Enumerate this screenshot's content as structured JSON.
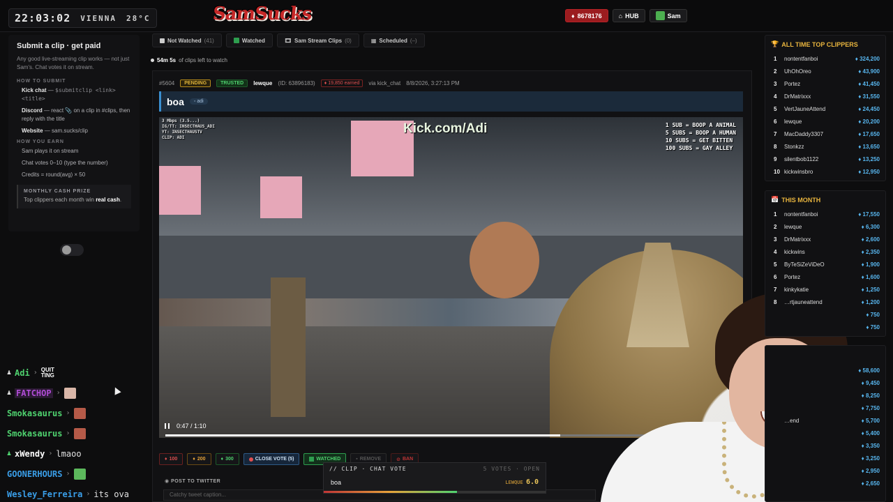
{
  "topbar": {
    "time": "22:03:02",
    "city": "VIENNA",
    "temp": "28°C",
    "logo": "SamSucks",
    "credits": "8678176",
    "hub_label": "HUB",
    "user": "Sam"
  },
  "sidebar": {
    "title": "Submit a clip · get paid",
    "description": "Any good live-streaming clip works — not just Sam's. Chat votes it on stream.",
    "how_to_submit_heading": "HOW TO SUBMIT",
    "kick_chat_label": "Kick chat",
    "kick_chat_cmd": "$submitclip <link> <title>",
    "discord_label": "Discord",
    "discord_text": "— react 📎 on a clip in #clips, then reply with the title",
    "website_label": "Website",
    "website_text": "— sam.sucks/clip",
    "how_you_earn_heading": "HOW YOU EARN",
    "earn_1": "Sam plays it on stream",
    "earn_2": "Chat votes 0–10 (type the number)",
    "earn_3": "Credits = round(avg) × 50",
    "prize_title": "MONTHLY CASH PRIZE",
    "prize_text_1": "Top clippers each month win",
    "prize_text_bold": "real cash",
    "prize_text_end": "."
  },
  "chat": [
    {
      "user": "Adi",
      "color": "#4fd26f",
      "text": "",
      "emote": "QUIT TING"
    },
    {
      "user": "FATCHOP",
      "color": "#b04cd6",
      "text": "",
      "emote": ""
    },
    {
      "user": "Smokasaurus",
      "color": "#4fd26f",
      "text": "",
      "emote": ""
    },
    {
      "user": "Smokasaurus",
      "color": "#4fd26f",
      "text": "",
      "emote": ""
    },
    {
      "user": "xWendy",
      "color": "#ffffff",
      "text": "lmaoo",
      "emote": ""
    },
    {
      "user": "GOONERHOURS",
      "color": "#3a9ee8",
      "text": "",
      "emote": ""
    },
    {
      "user": "Wesley_Ferreira",
      "color": "#3a9ee8",
      "text": "its ova",
      "emote": ""
    }
  ],
  "tabs": [
    {
      "label": "Not Watched",
      "count": "(41)"
    },
    {
      "label": "Watched",
      "count": ""
    },
    {
      "label": "Sam Stream Clips",
      "count": "(0)"
    },
    {
      "label": "Scheduled",
      "count": "(–)"
    }
  ],
  "left_to_watch": {
    "time": "54m 5s",
    "text": "of clips left to watch"
  },
  "clip": {
    "id": "#5604",
    "status": "PENDING",
    "trust": "TRUSTED",
    "user": "lewque",
    "user_id": "(ID: 63896183)",
    "earned": "19,850 earned",
    "via": "via kick_chat",
    "date": "8/8/2026, 3:27:13 PM",
    "title": "boa",
    "title_tag": "adi",
    "video_watermark": "Kick.com/Adi",
    "video_rules": [
      "1 SUB = BOOP A ANIMAL",
      "5 SUBS = BOOP A HUMAN",
      "10 SUBS = GET BITTEN",
      "100 SUBS = GAY ALLEY"
    ],
    "video_corner": [
      "3 Mbps (3.5...)",
      "IG/TT: INSECTHAUS_ADI",
      "YT: INSECTHAUSTV",
      "CLIP: ADI"
    ],
    "time_display": "0:47 / 1:10",
    "progress": 0.69
  },
  "actions": {
    "vote_100": "100",
    "vote_200": "200",
    "vote_300": "300",
    "close_vote": "CLOSE VOTE (5)",
    "watched": "WATCHED",
    "remove": "REMOVE",
    "ban": "BAN"
  },
  "twitter": {
    "heading": "POST TO TWITTER",
    "placeholder": "Catchy tweet caption..."
  },
  "vote_overlay": {
    "title": "// CLIP · CHAT VOTE",
    "status": "5 VOTES · OPEN",
    "clip_name": "boa",
    "user": "LEWQUE",
    "score": "6.0",
    "score_fraction": 0.6
  },
  "leaderboard_all_time": {
    "title": "ALL TIME TOP CLIPPERS",
    "rows": [
      {
        "rank": "1",
        "name": "nontentfanboi",
        "amount": "324,200"
      },
      {
        "rank": "2",
        "name": "UhOhOreo",
        "amount": "43,900"
      },
      {
        "rank": "3",
        "name": "Portez",
        "amount": "41,450"
      },
      {
        "rank": "4",
        "name": "DrMatrixxx",
        "amount": "31,550"
      },
      {
        "rank": "5",
        "name": "VertJauneAttend",
        "amount": "24,450"
      },
      {
        "rank": "6",
        "name": "lewque",
        "amount": "20,200"
      },
      {
        "rank": "7",
        "name": "MacDaddy3307",
        "amount": "17,650"
      },
      {
        "rank": "8",
        "name": "Stonkzz",
        "amount": "13,650"
      },
      {
        "rank": "9",
        "name": "silentbob1122",
        "amount": "13,250"
      },
      {
        "rank": "10",
        "name": "kickwinsbro",
        "amount": "12,950"
      }
    ]
  },
  "leaderboard_month": {
    "title": "THIS MONTH",
    "rows": [
      {
        "rank": "1",
        "name": "nontentfanboi",
        "amount": "17,550"
      },
      {
        "rank": "2",
        "name": "lewque",
        "amount": "6,300"
      },
      {
        "rank": "3",
        "name": "DrMatrixxx",
        "amount": "2,600"
      },
      {
        "rank": "4",
        "name": "kickwins",
        "amount": "2,350"
      },
      {
        "rank": "5",
        "name": "ByTeSiZeViDeO",
        "amount": "1,900"
      },
      {
        "rank": "6",
        "name": "Portez",
        "amount": "1,600"
      },
      {
        "rank": "7",
        "name": "kinkykatie",
        "amount": "1,250"
      },
      {
        "rank": "8",
        "name": "…rtjauneattend",
        "amount": "1,200"
      },
      {
        "rank": "",
        "name": "",
        "amount": "750"
      },
      {
        "rank": "",
        "name": "",
        "amount": "750"
      }
    ]
  },
  "leaderboard_third": {
    "rows": [
      {
        "rank": "",
        "name": "",
        "amount": "58,600"
      },
      {
        "rank": "",
        "name": "",
        "amount": "9,450"
      },
      {
        "rank": "",
        "name": "",
        "amount": "8,250"
      },
      {
        "rank": "",
        "name": "",
        "amount": "7,750"
      },
      {
        "rank": "",
        "name": "…end",
        "amount": "5,700"
      },
      {
        "rank": "",
        "name": "",
        "amount": "5,400"
      },
      {
        "rank": "",
        "name": "",
        "amount": "3,350"
      },
      {
        "rank": "",
        "name": "",
        "amount": "3,250"
      },
      {
        "rank": "",
        "name": "",
        "amount": "2,950"
      },
      {
        "rank": "",
        "name": "",
        "amount": "2,650"
      }
    ]
  },
  "colors": {
    "accent_red": "#9b1c1f",
    "accent_gold": "#e9b53e",
    "accent_blue": "#58b7f0",
    "accent_green": "#4fd26f"
  }
}
